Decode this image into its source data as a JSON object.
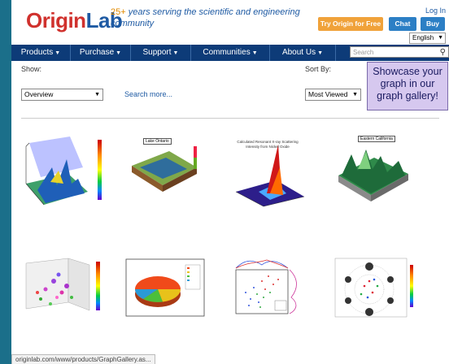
{
  "header": {
    "logo_o": "Origin",
    "logo_lab": "Lab",
    "tagline_highlight": "25+",
    "tagline_rest": " years serving the scientific and engineering",
    "tagline_line2": "community",
    "login": "Log In",
    "try_button": "Try Origin for Free",
    "chat_button": "Chat",
    "buy_button": "Buy",
    "language": "English"
  },
  "nav": {
    "items": [
      {
        "label": "Products"
      },
      {
        "label": "Purchase"
      },
      {
        "label": "Support"
      },
      {
        "label": "Communities"
      },
      {
        "label": "About Us"
      }
    ],
    "search_placeholder": "Search"
  },
  "filters": {
    "show_label": "Show:",
    "show_value": "Overview",
    "search_more": "Search more...",
    "sort_label": "Sort By:",
    "sort_value": "Most Viewed"
  },
  "promo": {
    "text_line1": "Showcase your",
    "text_line2": "graph in our",
    "text_line3": "graph gallery!"
  },
  "gallery": {
    "thumb2_title": "Lake Ontario",
    "thumb3_title": "Calculated Resonant X-ray Scattering Intensity from Nickel Oxide",
    "thumb4_title": "Eastern California"
  },
  "status_bar": "originlab.com/www/products/GraphGallery.as...",
  "colors": {
    "nav_bg": "#0d3b78",
    "accent_orange": "#f0a23a",
    "accent_blue": "#2c7fc5",
    "promo_bg": "#d6c8ef",
    "page_border": "#1b6f8a"
  }
}
